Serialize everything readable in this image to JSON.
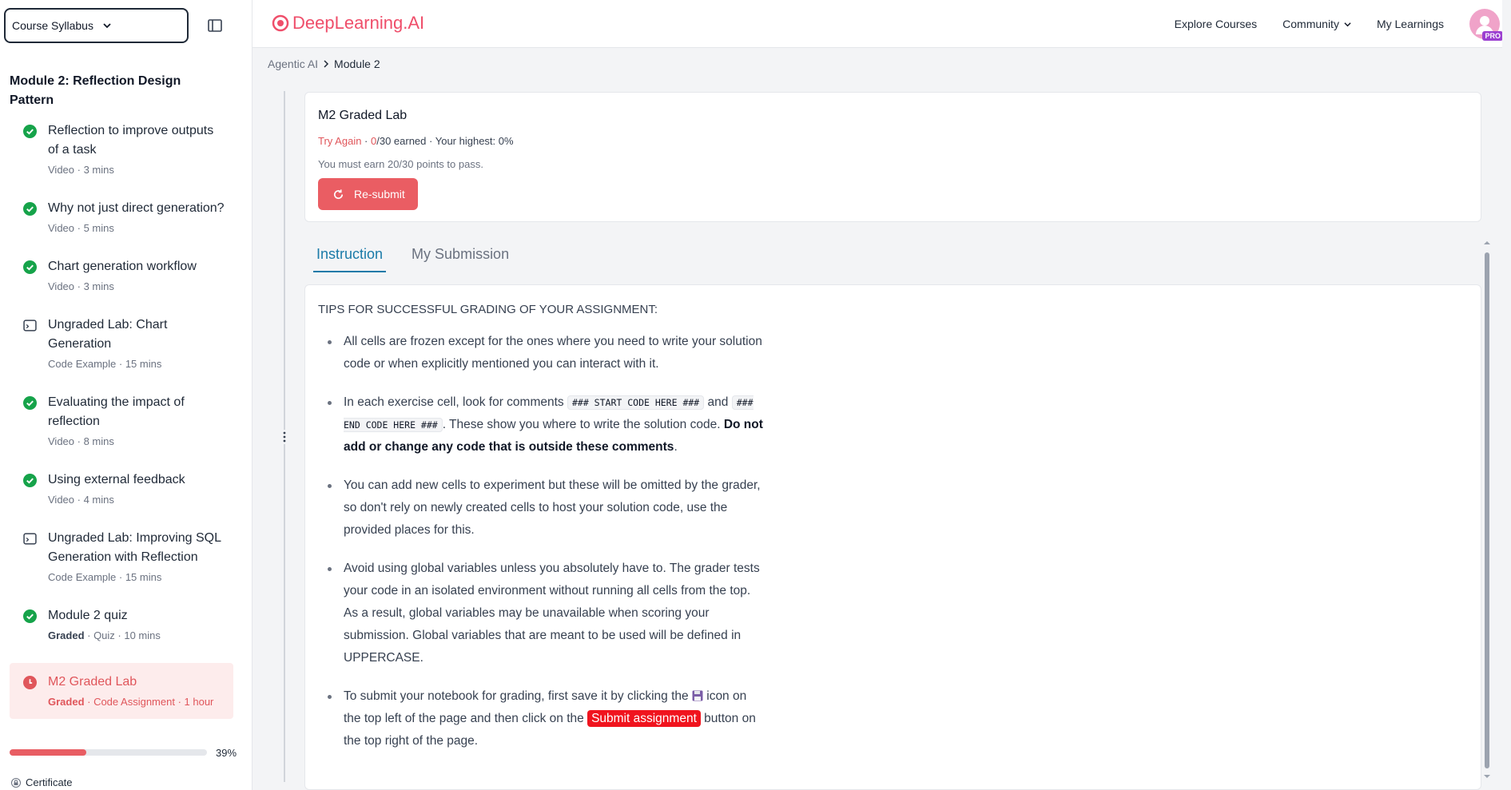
{
  "sidebar": {
    "syllabus_label": "Course Syllabus",
    "module_title": "Module 2: Reflection Design Pattern",
    "items": [
      {
        "title": "Reflection to improve outputs of a task",
        "graded": "",
        "meta": "Video · 3 mins",
        "status": "complete"
      },
      {
        "title": "Why not just direct generation?",
        "graded": "",
        "meta": "Video · 5 mins",
        "status": "complete"
      },
      {
        "title": "Chart generation workflow",
        "graded": "",
        "meta": "Video · 3 mins",
        "status": "complete"
      },
      {
        "title": "Ungraded Lab: Chart Generation",
        "graded": "",
        "meta": "Code Example · 15 mins",
        "status": "lab"
      },
      {
        "title": "Evaluating the impact of reflection",
        "graded": "",
        "meta": "Video · 8 mins",
        "status": "complete"
      },
      {
        "title": "Using external feedback",
        "graded": "",
        "meta": "Video · 4 mins",
        "status": "complete"
      },
      {
        "title": "Ungraded Lab: Improving SQL Generation with Reflection",
        "graded": "",
        "meta": "Code Example · 15 mins",
        "status": "lab"
      },
      {
        "title": "Module 2 quiz",
        "graded": "Graded",
        "meta": " · Quiz · 10 mins",
        "status": "complete"
      },
      {
        "title": "M2 Graded Lab",
        "graded": "Graded",
        "meta": " · Code Assignment · 1 hour",
        "status": "active"
      }
    ],
    "progress_percent": 39,
    "progress_label": "39%",
    "certificate_label": "Certificate"
  },
  "header": {
    "logo_text": "DeepLearning.AI",
    "nav": {
      "explore": "Explore Courses",
      "community": "Community",
      "my_learnings": "My Learnings"
    },
    "avatar_badge": "PRO"
  },
  "breadcrumb": {
    "parent": "Agentic AI",
    "current": "Module 2"
  },
  "lab": {
    "title": "M2 Graded Lab",
    "try_again": "Try Again",
    "earned_score": "0",
    "earned_rest": "/30 earned",
    "highest": "Your highest: 0%",
    "pass_text": "You must earn 20/30 points to pass.",
    "resubmit_label": "Re-submit"
  },
  "tabs": {
    "instruction": "Instruction",
    "submission": "My Submission"
  },
  "instructions": {
    "heading": "TIPS FOR SUCCESSFUL GRADING OF YOUR ASSIGNMENT:",
    "b1": "All cells are frozen except for the ones where you need to write your solution code or when explicitly mentioned you can interact with it.",
    "b2_a": "In each exercise cell, look for comments ",
    "b2_code1": "### START CODE HERE ###",
    "b2_b": " and ",
    "b2_code2": "### END CODE HERE ###",
    "b2_c": ". These show you where to write the solution code. ",
    "b2_bold": "Do not add or change any code that is outside these comments",
    "b2_d": ".",
    "b3": "You can add new cells to experiment but these will be omitted by the grader, so don't rely on newly created cells to host your solution code, use the provided places for this.",
    "b4": "Avoid using global variables unless you absolutely have to. The grader tests your code in an isolated environment without running all cells from the top. As a result, global variables may be unavailable when scoring your submission. Global variables that are meant to be used will be defined in UPPERCASE.",
    "b5_a": "To submit your notebook for grading, first save it by clicking the ",
    "b5_b": " icon on the top left of the page and then click on the ",
    "b5_badge": "Submit assignment",
    "b5_c": " button on the top right of the page."
  },
  "colors": {
    "accent": "#ea5d63",
    "link": "#1a7aa8",
    "complete": "#16a34a"
  }
}
